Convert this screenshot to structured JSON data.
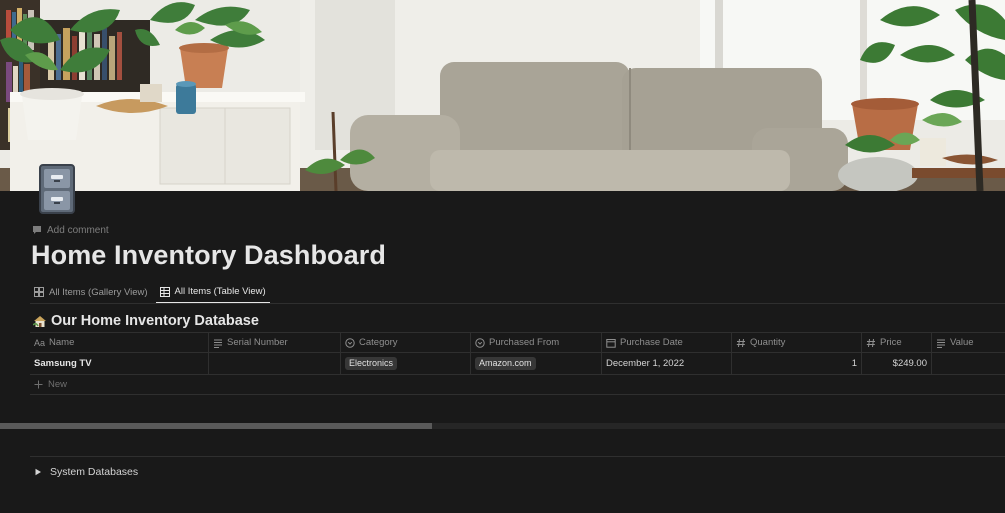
{
  "page": {
    "icon": "filing-cabinet-icon",
    "add_comment": "Add comment",
    "title": "Home Inventory Dashboard"
  },
  "tabs": [
    {
      "label": "All Items (Gallery View)",
      "icon": "gallery-grid-icon",
      "active": false
    },
    {
      "label": "All Items (Table View)",
      "icon": "table-icon",
      "active": true
    }
  ],
  "database": {
    "icon": "house-icon",
    "title": "Our Home Inventory Database",
    "columns": [
      {
        "label": "Name",
        "prefix": "Aa",
        "icon": "text-icon"
      },
      {
        "label": "Serial Number",
        "icon": "text-lines-icon"
      },
      {
        "label": "Category",
        "icon": "select-icon"
      },
      {
        "label": "Purchased From",
        "icon": "select-icon"
      },
      {
        "label": "Purchase Date",
        "icon": "calendar-icon"
      },
      {
        "label": "Quantity",
        "icon": "number-icon"
      },
      {
        "label": "Price",
        "icon": "number-icon"
      },
      {
        "label": "Value",
        "icon": "text-lines-icon"
      }
    ],
    "rows": [
      {
        "name": "Samsung TV",
        "serial_number": "",
        "category": "Electronics",
        "purchased_from": "Amazon.com",
        "purchase_date": "December 1, 2022",
        "quantity": "1",
        "price": "$249.00",
        "value": ""
      }
    ],
    "new_label": "New",
    "scroll_fraction": 0.43
  },
  "toggle": {
    "label": "System Databases",
    "expanded": false
  },
  "colors": {
    "background": "#191919",
    "text": "#d4d4d4",
    "tag_bg": "#373737"
  }
}
